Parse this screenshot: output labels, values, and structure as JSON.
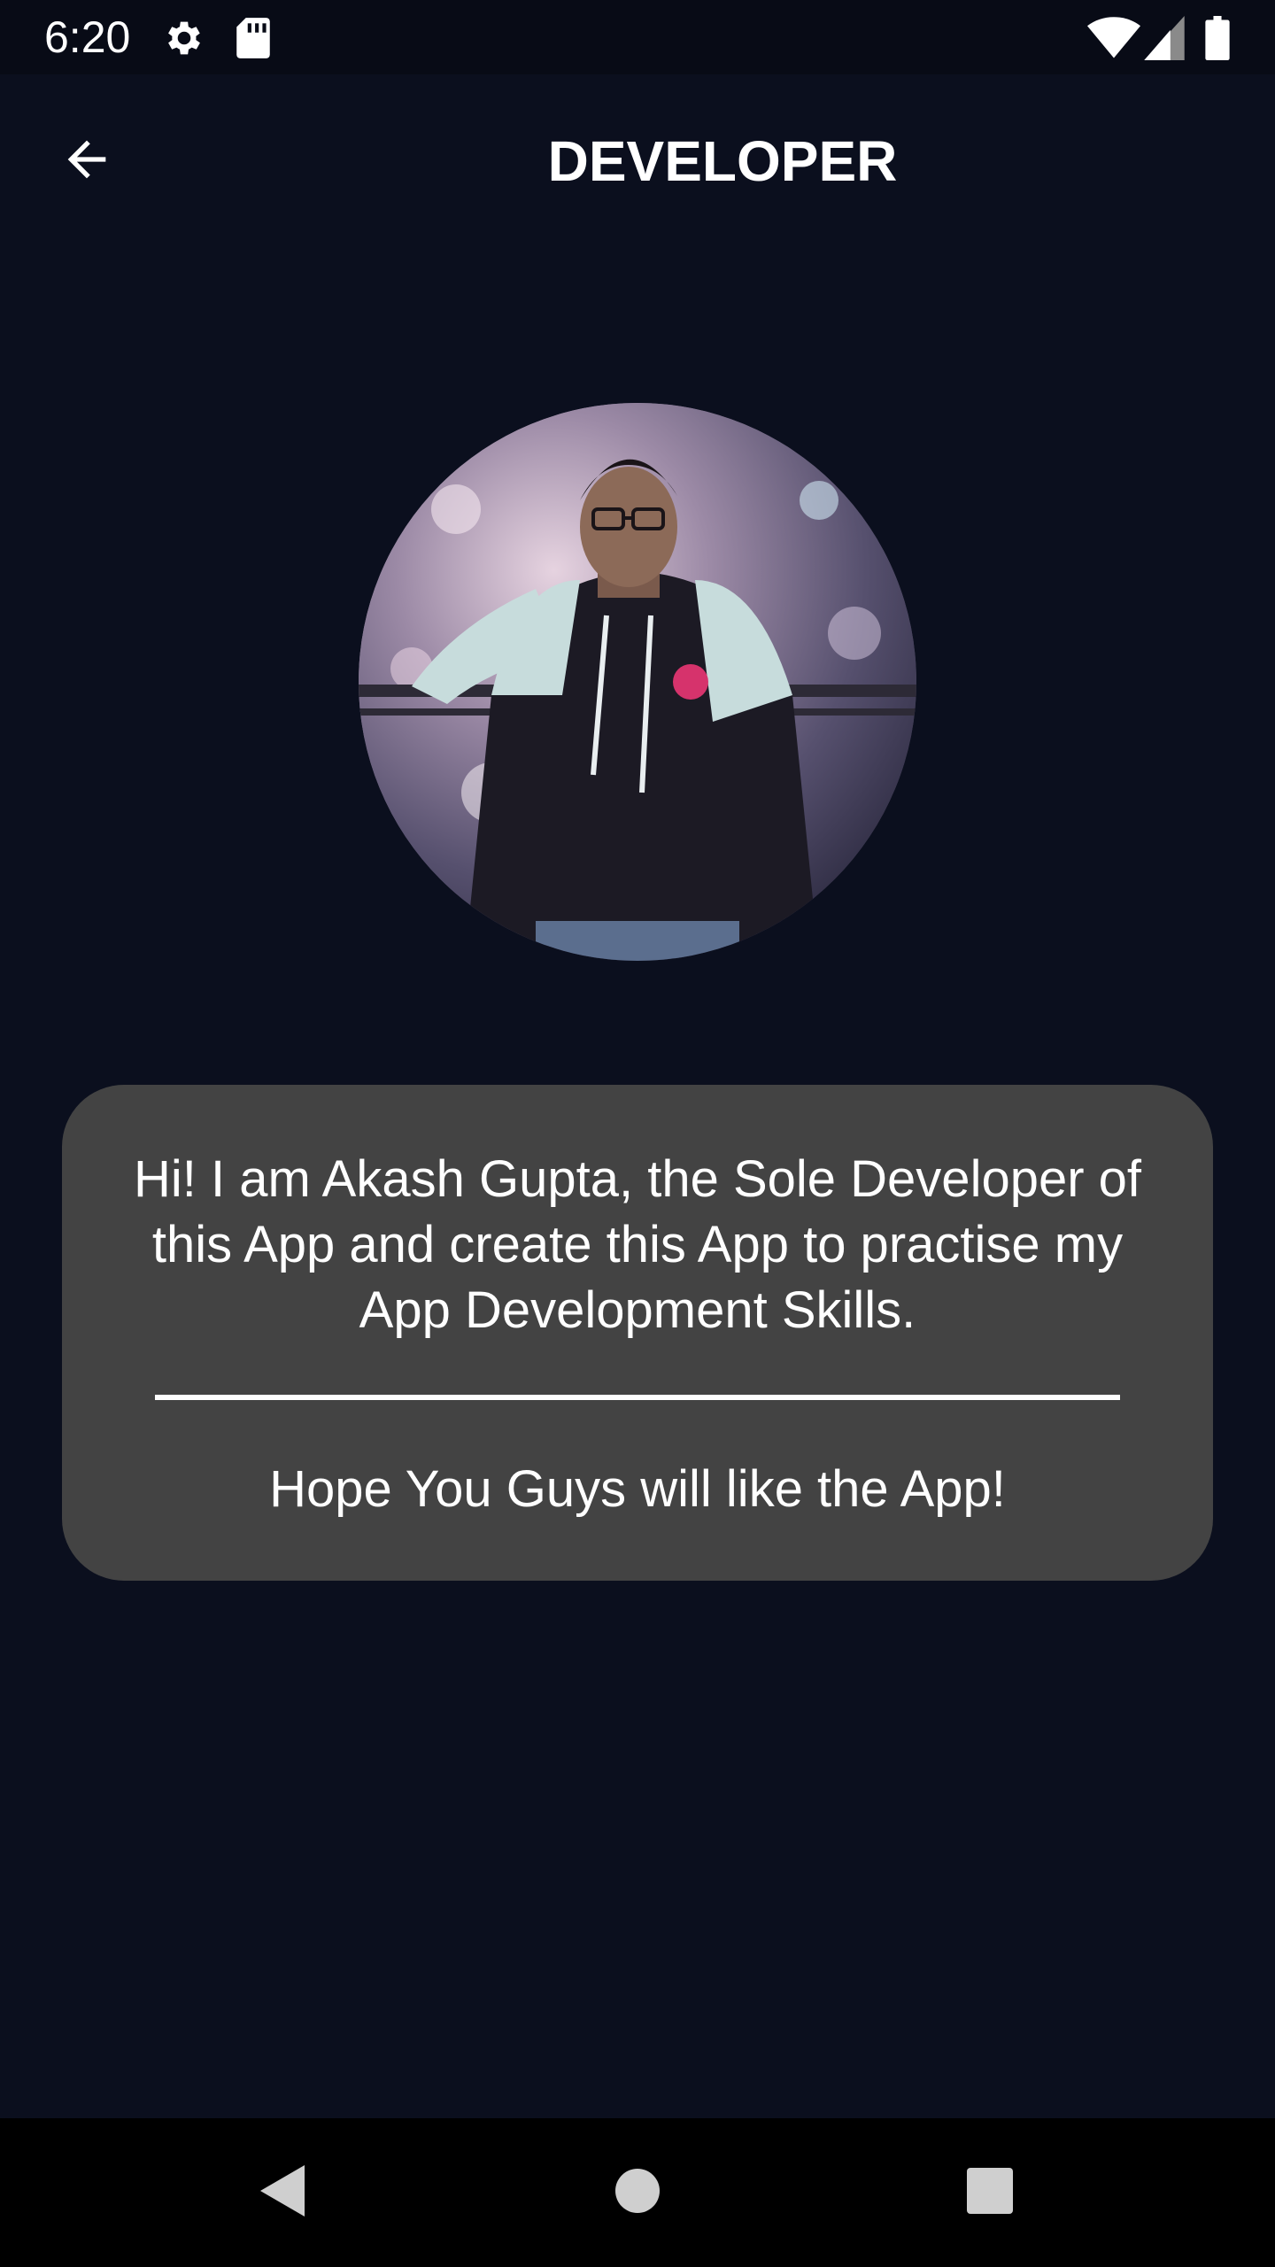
{
  "status_bar": {
    "time": "6:20",
    "icons": [
      "gear-icon",
      "sd-card-icon",
      "wifi-icon",
      "signal-icon",
      "battery-icon"
    ]
  },
  "app_bar": {
    "title": "DEVELOPER",
    "back_icon": "arrow-left-icon"
  },
  "avatar": {
    "kind": "developer-photo"
  },
  "card": {
    "intro": "Hi! I am Akash Gupta, the Sole Developer of this App and create this App to practise my App Development Skills.",
    "outro": "Hope You Guys will like the App!"
  },
  "nav_bar": {
    "icons": [
      "nav-back-icon",
      "nav-home-icon",
      "nav-recents-icon"
    ]
  },
  "colors": {
    "background": "#0b0f1e",
    "card": "#434343",
    "text": "#ffffff",
    "nav_bar": "#000000"
  }
}
